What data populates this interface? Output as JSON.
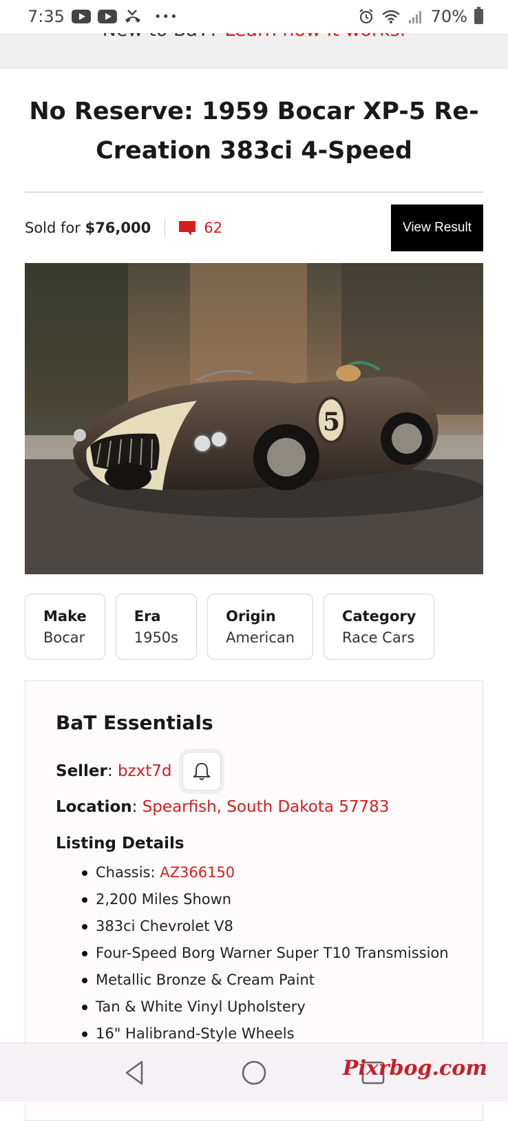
{
  "status_bar": {
    "time": "7:35",
    "battery": "70%"
  },
  "banner": {
    "prefix": "New to BaT? ",
    "link": "Learn how it works."
  },
  "listing": {
    "title": "No Reserve: 1959 Bocar XP-5 Re-Creation 383ci 4-Speed",
    "sold_prefix": "Sold for ",
    "sold_price": "$76,000",
    "comment_count": "62",
    "view_result_label": "View Result"
  },
  "chips": [
    {
      "key": "Make",
      "value": "Bocar"
    },
    {
      "key": "Era",
      "value": "1950s"
    },
    {
      "key": "Origin",
      "value": "American"
    },
    {
      "key": "Category",
      "value": "Race Cars"
    }
  ],
  "essentials": {
    "heading": "BaT Essentials",
    "seller_label": "Seller",
    "seller_value": "bzxt7d",
    "location_label": "Location",
    "location_value": "Spearfish, South Dakota 57783",
    "details_heading": "Listing Details",
    "chassis_label": "Chassis: ",
    "chassis_value": "AZ366150",
    "details": [
      "2,200 Miles Shown",
      "383ci Chevrolet V8",
      "Four-Speed Borg Warner Super T10 Transmission",
      "Metallic Bronze & Cream Paint",
      "Tan & White Vinyl Upholstery",
      "16\" Halibrand-Style Wheels"
    ]
  },
  "watermark": "Pixrbog.com",
  "colors": {
    "accent": "#d41f1f",
    "button": "#000000"
  }
}
